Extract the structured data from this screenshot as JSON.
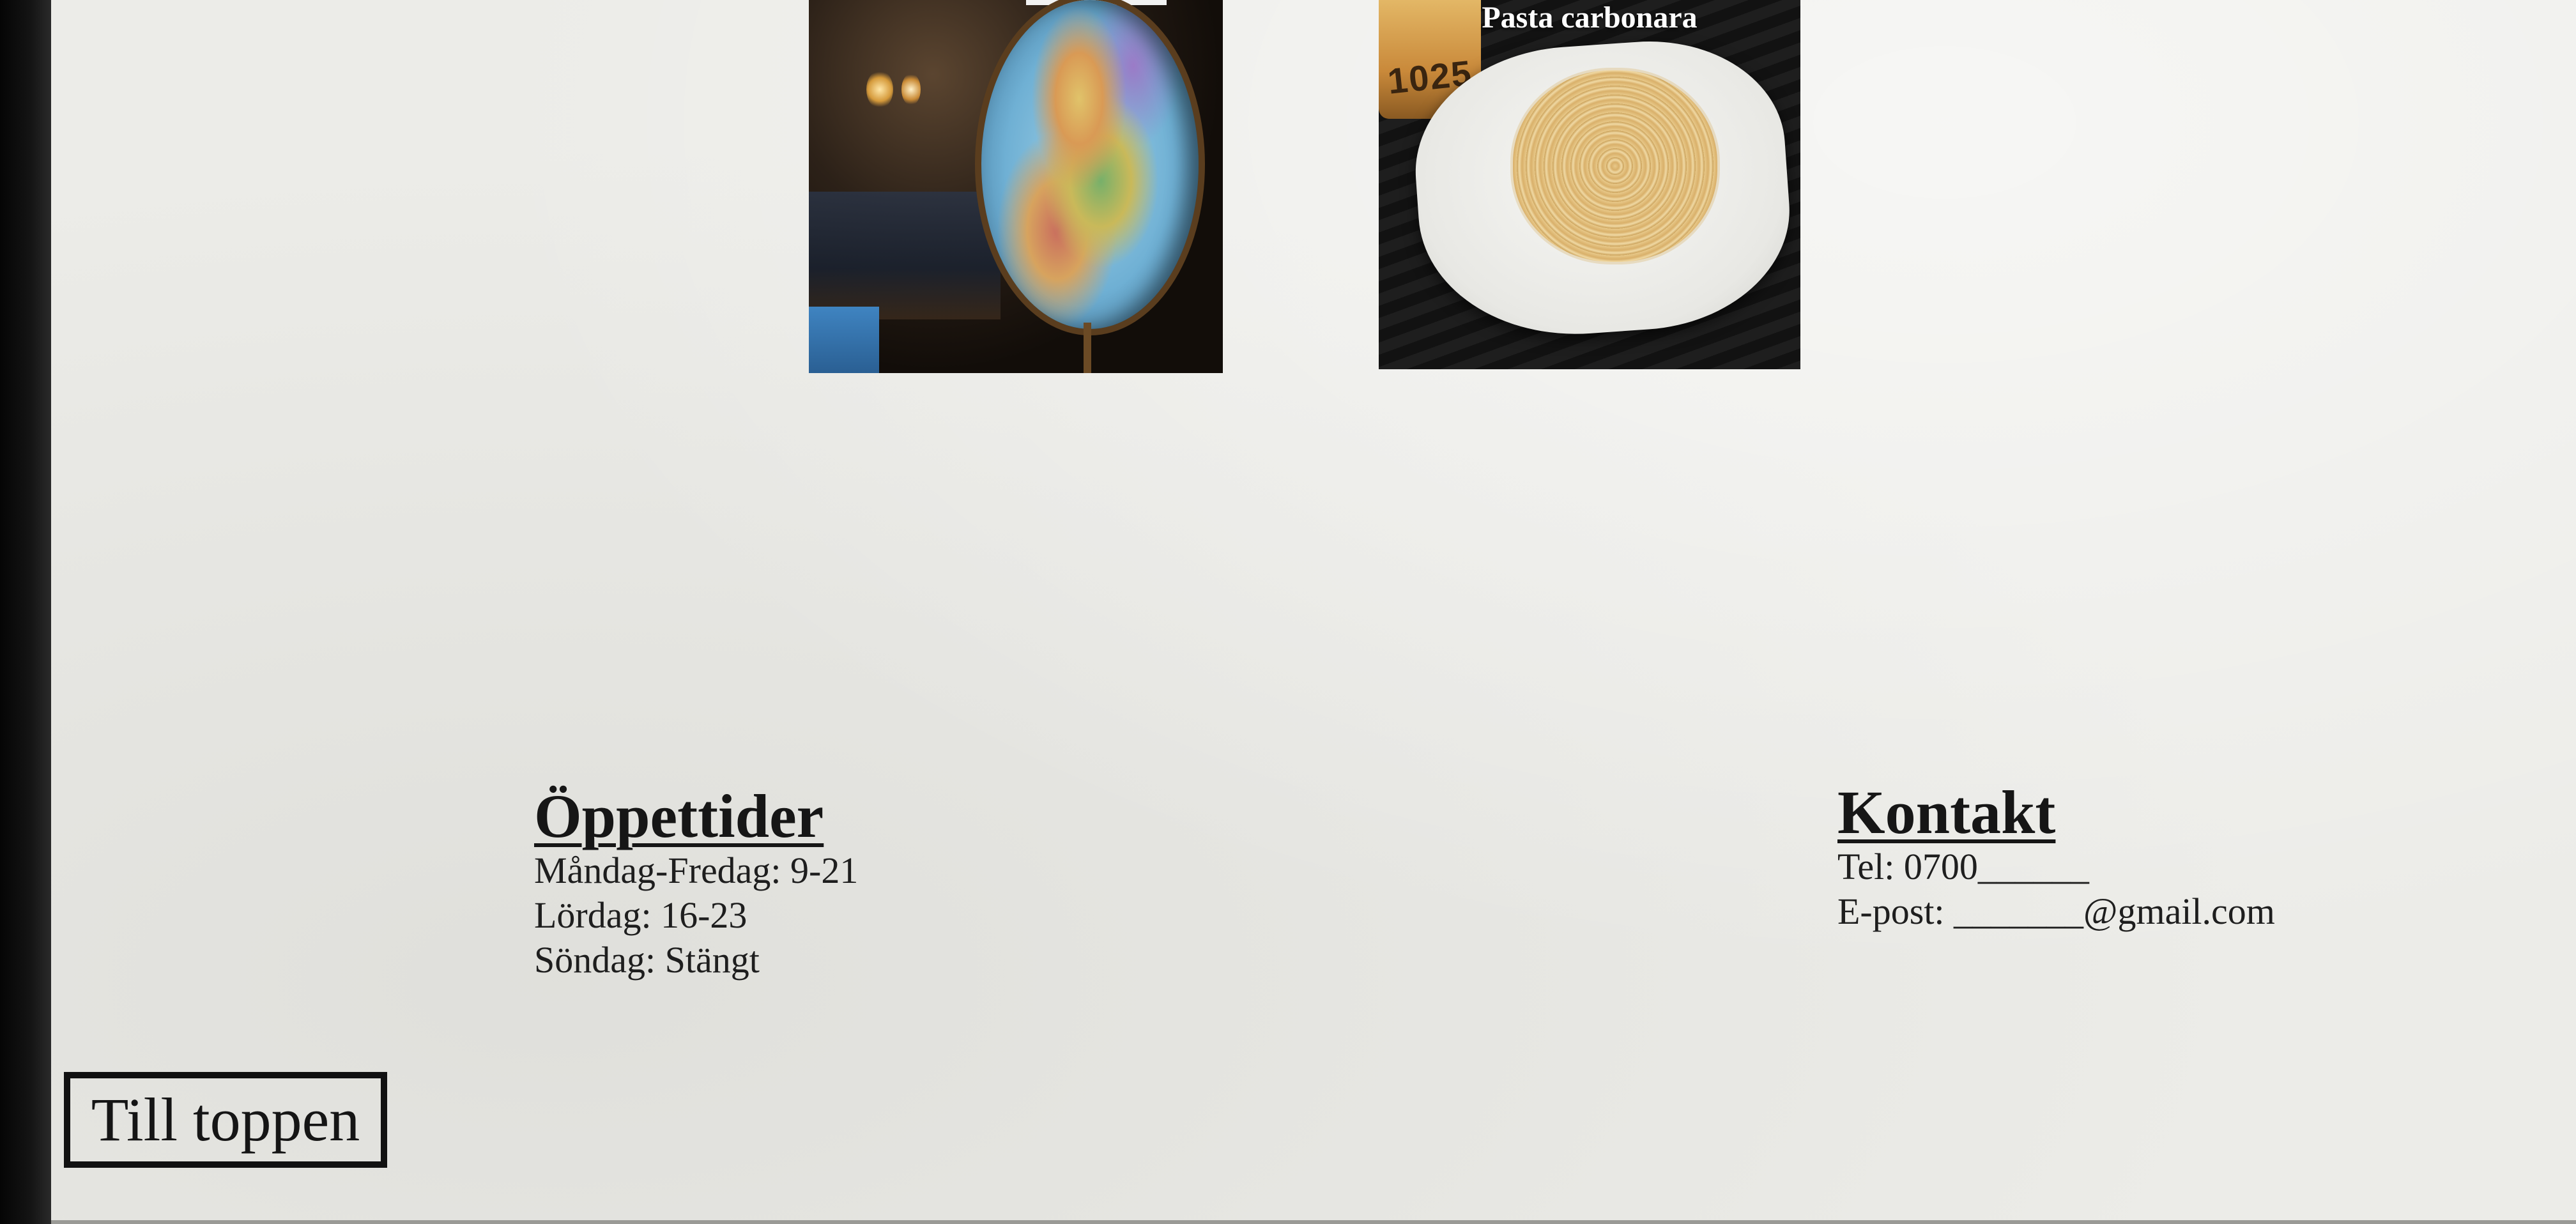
{
  "gallery": {
    "items": [
      {
        "image": "globe-photo",
        "caption": ""
      },
      {
        "image": "pasta-photo",
        "caption": "Pasta carbonara"
      }
    ],
    "pasta_cheese_mark": "1025"
  },
  "hours": {
    "title": "Öppettider",
    "lines": [
      "Måndag-Fredag: 9-21",
      "Lördag: 16-23",
      "Söndag: Stängt"
    ]
  },
  "contact": {
    "title": "Kontakt",
    "phone": "Tel: 0700______",
    "email": "E-post: _______@gmail.com"
  },
  "navigation": {
    "back_to_top_label": "Till toppen"
  }
}
